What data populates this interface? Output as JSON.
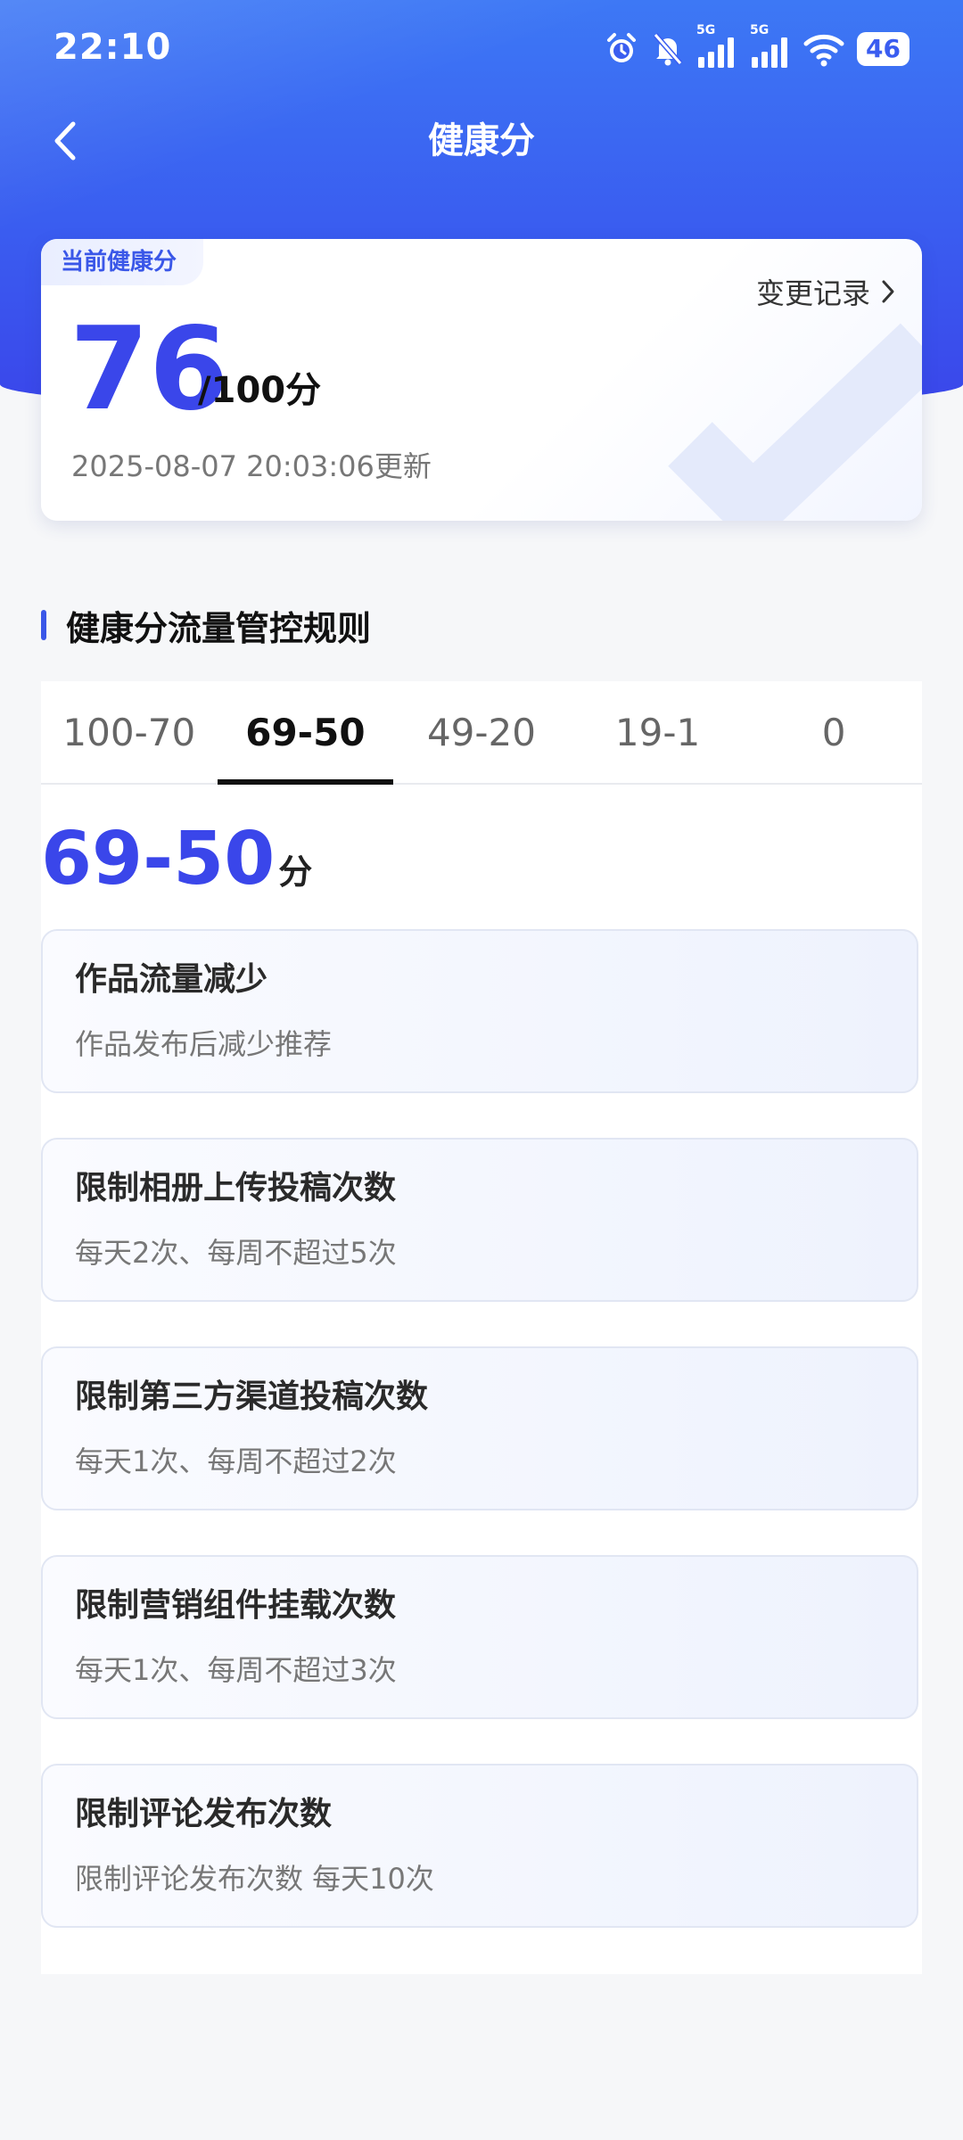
{
  "status_bar": {
    "time": "22:10",
    "network_1": "5G",
    "network_2": "5G",
    "battery": "46",
    "icons": [
      "alarm-icon",
      "mute-icon",
      "signal-icon",
      "signal-icon",
      "wifi-icon",
      "battery-icon"
    ]
  },
  "nav": {
    "title": "健康分",
    "back_icon": "chevron-left-icon"
  },
  "score_card": {
    "tag": "当前健康分",
    "change_record": "变更记录",
    "score": "76",
    "total": "/100分",
    "updated": "2025-08-07 20:03:06更新",
    "accent_color": "#3a46ea"
  },
  "section": {
    "title": "健康分流量管控规则"
  },
  "tabs": [
    {
      "label": "100-70",
      "active": false
    },
    {
      "label": "69-50",
      "active": true
    },
    {
      "label": "49-20",
      "active": false
    },
    {
      "label": "19-1",
      "active": false
    },
    {
      "label": "0",
      "active": false
    }
  ],
  "range": {
    "value": "69-50",
    "unit": "分"
  },
  "rules": [
    {
      "title": "作品流量减少",
      "desc": "作品发布后减少推荐"
    },
    {
      "title": "限制相册上传投稿次数",
      "desc": "每天2次、每周不超过5次"
    },
    {
      "title": "限制第三方渠道投稿次数",
      "desc": "每天1次、每周不超过2次"
    },
    {
      "title": "限制营销组件挂载次数",
      "desc": "每天1次、每周不超过3次"
    },
    {
      "title": "限制评论发布次数",
      "desc": "限制评论发布次数 每天10次"
    }
  ]
}
